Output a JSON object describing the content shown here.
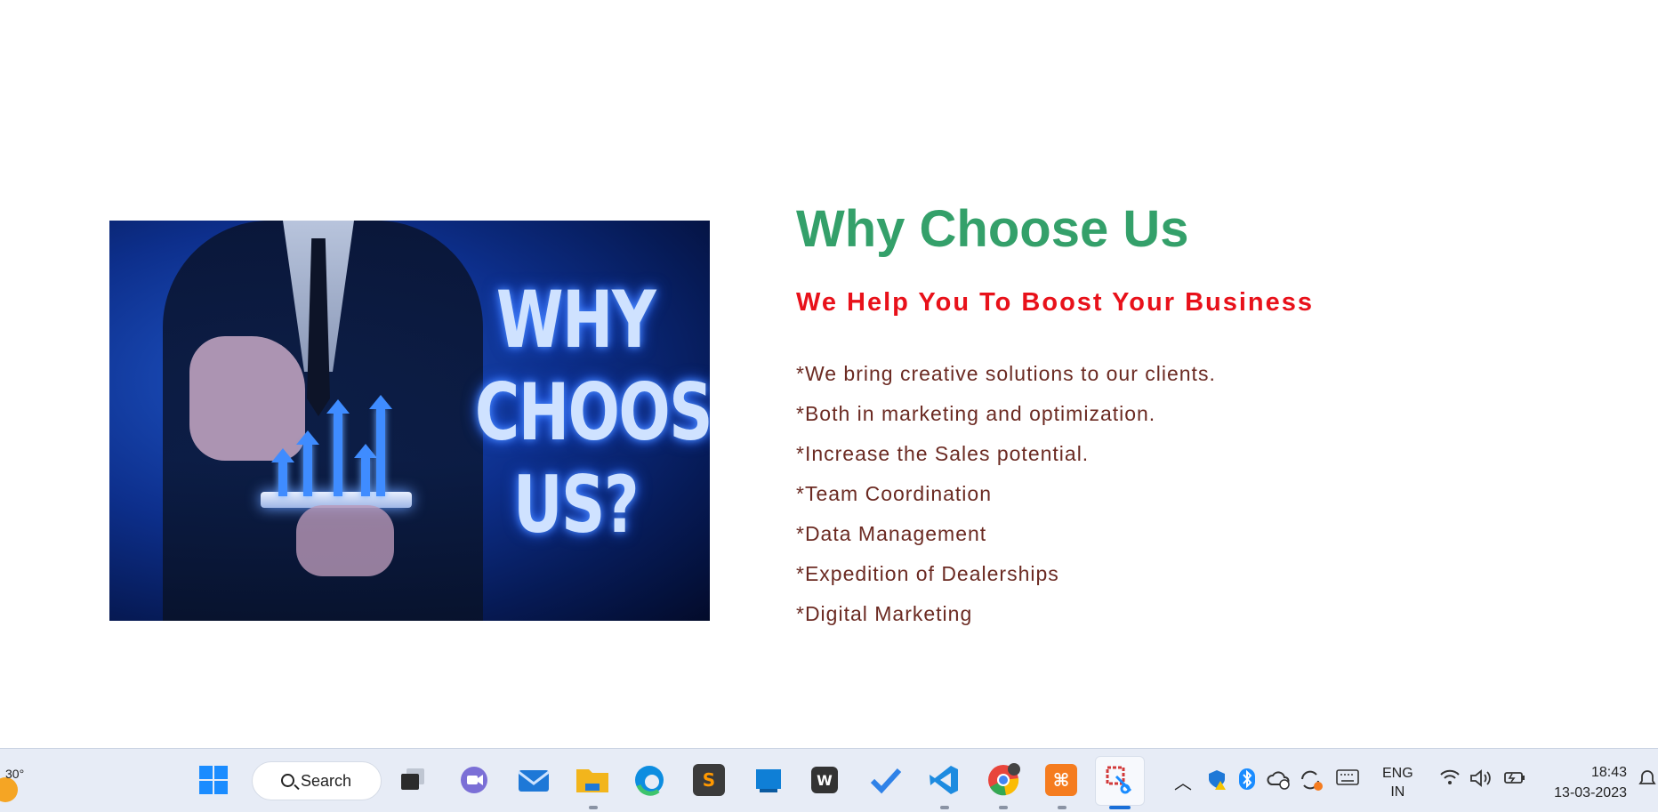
{
  "main": {
    "hero_image_text": "WHY CHOOSE US?",
    "heading": "Why Choose Us",
    "subheading": "We Help You To Boost Your Business",
    "features": [
      "*We bring creative solutions to our clients.",
      "*Both in marketing and optimization.",
      "*Increase the Sales potential.",
      "*Team Coordination",
      "*Data Management",
      "*Expedition of Dealerships",
      "*Digital Marketing"
    ],
    "colors": {
      "heading": "#34a06a",
      "subheading": "#e8111a",
      "features": "#6b2a22"
    }
  },
  "taskbar": {
    "weather_temp": "30°",
    "search_label": "Search",
    "apps": [
      {
        "name": "windows-start-icon"
      },
      {
        "name": "task-view-icon"
      },
      {
        "name": "teams-chat-icon"
      },
      {
        "name": "mail-icon"
      },
      {
        "name": "file-explorer-icon"
      },
      {
        "name": "edge-icon"
      },
      {
        "name": "sublime-text-icon"
      },
      {
        "name": "store-icon"
      },
      {
        "name": "word-w-icon"
      },
      {
        "name": "todo-icon"
      },
      {
        "name": "vscode-icon"
      },
      {
        "name": "chrome-icon"
      },
      {
        "name": "xampp-icon"
      },
      {
        "name": "snipping-tool-icon"
      }
    ],
    "language_line1": "ENG",
    "language_line2": "IN",
    "time": "18:43",
    "date": "13-03-2023"
  }
}
